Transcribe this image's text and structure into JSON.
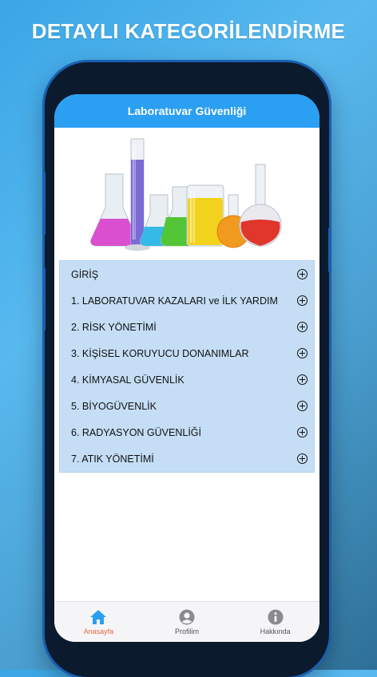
{
  "promo": {
    "headline": "DETAYLI KATEGORİLENDİRME"
  },
  "app": {
    "title": "Laboratuvar Güvenliği"
  },
  "menu": {
    "items": [
      {
        "label": "GİRİŞ"
      },
      {
        "label": "1. LABORATUVAR KAZALARI ve İLK YARDIM"
      },
      {
        "label": "2. RİSK YÖNETİMİ"
      },
      {
        "label": "3. KİŞİSEL KORUYUCU DONANIMLAR"
      },
      {
        "label": "4. KİMYASAL GÜVENLİK"
      },
      {
        "label": "5. BİYOGÜVENLİK"
      },
      {
        "label": "6. RADYASYON GÜVENLİĞİ"
      },
      {
        "label": "7. ATIK YÖNETİMİ"
      }
    ]
  },
  "tabbar": {
    "tabs": [
      {
        "label": "Anasayfa",
        "icon": "home-icon",
        "active": true
      },
      {
        "label": "Profilim",
        "icon": "profile-icon",
        "active": false
      },
      {
        "label": "Hakkında",
        "icon": "info-icon",
        "active": false
      }
    ]
  },
  "colors": {
    "appbar": "#2b9ff2",
    "menu_bg": "#c5def5",
    "active_tab": "#e86a3c",
    "phone_frame": "#1a5fb0"
  }
}
